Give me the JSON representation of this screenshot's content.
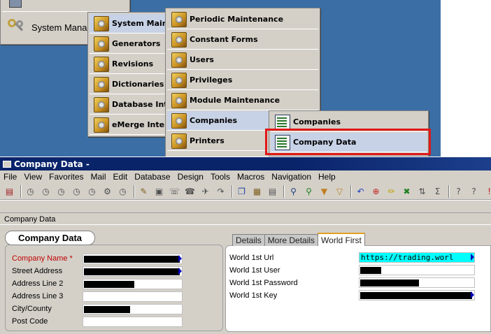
{
  "start_menu": {
    "partial_top_item": "",
    "system_item": "System Mana"
  },
  "menu_level1": [
    {
      "label": "System Maint"
    },
    {
      "label": "Generators"
    },
    {
      "label": "Revisions"
    },
    {
      "label": "Dictionaries"
    },
    {
      "label": "Database Int"
    },
    {
      "label": "eMerge Inter"
    }
  ],
  "menu_level2": [
    {
      "label": "Periodic Maintenance"
    },
    {
      "label": "Constant Forms"
    },
    {
      "label": "Users"
    },
    {
      "label": "Privileges"
    },
    {
      "label": "Module Maintenance"
    },
    {
      "label": "Companies"
    },
    {
      "label": "Printers"
    }
  ],
  "menu_level3": [
    {
      "label": "Companies"
    },
    {
      "label": "Company Data"
    }
  ],
  "window": {
    "title": "Company Data -",
    "menu": [
      "File",
      "View",
      "Favorites",
      "Mail",
      "Edit",
      "Database",
      "Design",
      "Tools",
      "Macros",
      "Navigation",
      "Help"
    ],
    "breadcrumb": "Company Data"
  },
  "form": {
    "panel_title": "Company Data",
    "fields": [
      {
        "label": "Company Name *",
        "required": true
      },
      {
        "label": "Street Address",
        "required": false
      },
      {
        "label": "Address Line 2",
        "required": false
      },
      {
        "label": "Address Line 3",
        "required": false
      },
      {
        "label": "City/County",
        "required": false
      },
      {
        "label": "Post Code",
        "required": false
      }
    ]
  },
  "tabs": [
    {
      "label": "Details",
      "active": false
    },
    {
      "label": "More Details",
      "active": false
    },
    {
      "label": "World First",
      "active": true
    }
  ],
  "world_first": {
    "fields": [
      {
        "label": "World 1st Url",
        "value": "https://trading.worl"
      },
      {
        "label": "World 1st User",
        "value": ""
      },
      {
        "label": "World 1st Password",
        "value": ""
      },
      {
        "label": "World 1st Key",
        "value": ""
      }
    ]
  },
  "colors": {
    "desktop": "#3a6ea5",
    "highlight": "#c7d2e6",
    "callout": "#e01818",
    "title_bar": "#0a246a",
    "url_highlight": "#00ffff"
  }
}
